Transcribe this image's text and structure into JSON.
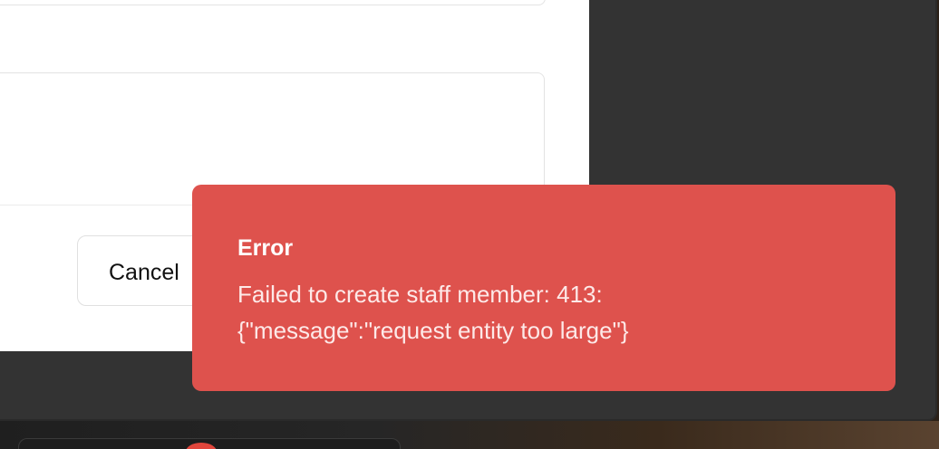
{
  "dialog": {
    "cancel_label": "Cancel"
  },
  "toast": {
    "title": "Error",
    "message_line1": "Failed to create staff member: 413:",
    "message_line2": "{\"message\":\"request entity too large\"}",
    "background_color": "#de524d"
  }
}
